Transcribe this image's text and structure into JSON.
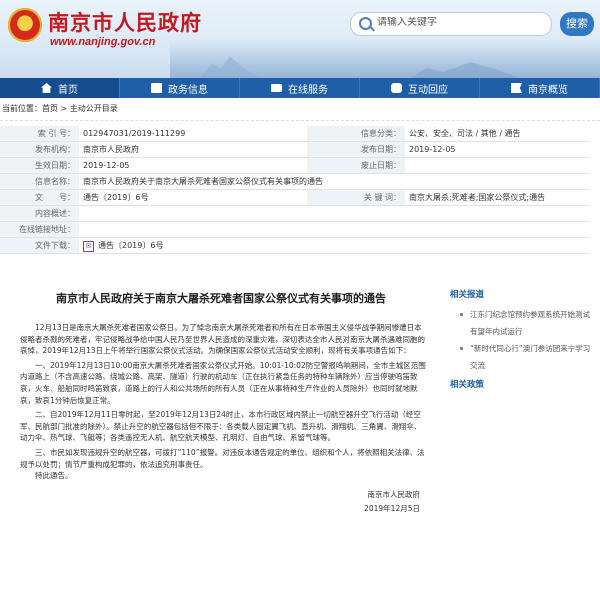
{
  "header": {
    "site_name": "南京市人民政府",
    "site_url": "www.nanjing.gov.cn",
    "search_placeholder": "请输入关键字",
    "search_button": "搜索"
  },
  "nav": {
    "items": [
      {
        "label": "首页",
        "icon": "home-icon"
      },
      {
        "label": "政务信息",
        "icon": "document-icon"
      },
      {
        "label": "在线服务",
        "icon": "monitor-icon"
      },
      {
        "label": "互动回应",
        "icon": "chat-icon"
      },
      {
        "label": "南京概览",
        "icon": "flag-icon"
      }
    ]
  },
  "breadcrumb": {
    "prefix": "当前位置：",
    "home": "首页",
    "sep": " > ",
    "current": "主动公开目录"
  },
  "info": {
    "index_label": "索 引 号：",
    "index_value": "012947031/2019-111299",
    "category_label": "信息分类：",
    "category_value": "公安、安全、司法 / 其他 / 通告",
    "org_label": "发布机构：",
    "org_value": "南京市人民政府",
    "date_label": "发布日期：",
    "date_value": "2019-12-05",
    "effective_label": "生效日期：",
    "effective_value": "2019-12-05",
    "repeal_label": "废止日期：",
    "repeal_value": "",
    "name_label": "信息名称：",
    "name_value": "南京市人民政府关于南京大屠杀死难者国家公祭仪式有关事项的通告",
    "docno_label": "文　　号：",
    "docno_value": "通告〔2019〕6号",
    "keyword_label": "关 键 词：",
    "keyword_value": "南京大屠杀;死难者;国家公祭仪式;通告",
    "content_label": "内容概述：",
    "content_value": "",
    "sign_label": "在线链接地址：",
    "sign_value": "",
    "attach_label": "文件下载：",
    "attach_value": "通告〔2019〕6号"
  },
  "article": {
    "title": "南京市人民政府关于南京大屠杀死难者国家公祭仪式有关事项的通告",
    "paragraphs": [
      "12月13日是南京大屠杀死难者国家公祭日。为了悼念南京大屠杀死难者和所有在日本帝国主义侵华战争期间惨遭日本侵略者杀戮的死难者，牢记侵略战争给中国人民乃至世界人民造成的深重灾难，深切表达全市人民对南京大屠杀遇难同胞的哀悼，2019年12月13日上午将举行国家公祭仪式活动。为确保国家公祭仪式活动安全顺利，现将有关事项通告如下：",
      "一、2019年12月13日10:00南京大屠杀死难者国家公祭仪式开始。10:01-10:02防空警报鸣响期间，全市主城区范围内道路上（不含高速公路、绕城公路、高架、隧道）行驶的机动车（正在执行紧急任务的特种车辆除外）应当停驶鸣笛致哀，火车、船舶同时鸣笛致哀，道路上的行人和公共场所的所有人员（正在从事特种生产作业的人员除外）也同时就地默哀，致哀1分钟后恢复正常。",
      "二、自2019年12月11日零时起，至2019年12月13日24时止，本市行政区域内禁止一切航空器升空飞行活动（经空军、民航部门批准的除外）。禁止升空的航空器包括但不限于：各类载人固定翼飞机、直升机、滑翔机、三角翼、滑翔伞、动力伞、热气球、飞艇等；各类遥控无人机、航空航天模型、孔明灯、自由气球、系留气球等。",
      "三、市民如发现违规升空的航空器，可拨打“110”报警。对违反本通告规定的单位、组织和个人，将依照相关法律、法规予以处罚；情节严重构成犯罪的，依法追究刑事责任。",
      "特此通告。"
    ],
    "signature": "南京市人民政府",
    "signature_date": "2019年12月5日"
  },
  "sidebar": {
    "related_reports": "相关报道",
    "report_items": [
      "江东门纪念馆预约参观系统开始测试 有望年内试运行",
      "“新时代同心行”澳门参访团来宁学习交流"
    ],
    "related_policies": "相关政策"
  },
  "colors": {
    "brand_red": "#c8161d",
    "nav_blue": "#1f5fa8",
    "link_blue": "#1f5fa8"
  }
}
